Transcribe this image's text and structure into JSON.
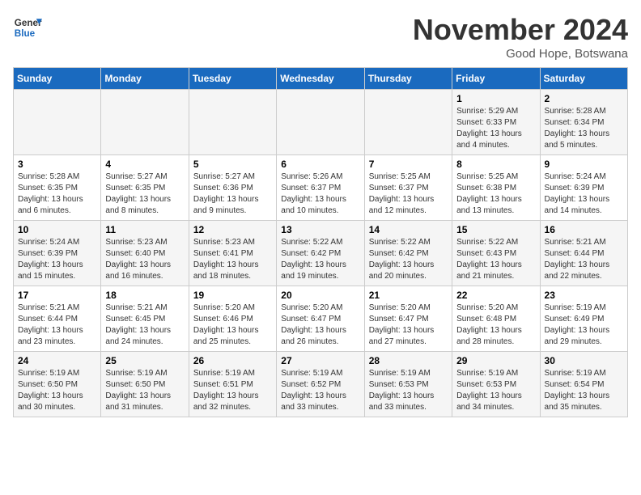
{
  "header": {
    "logo_line1": "General",
    "logo_line2": "Blue",
    "month_year": "November 2024",
    "location": "Good Hope, Botswana"
  },
  "days_of_week": [
    "Sunday",
    "Monday",
    "Tuesday",
    "Wednesday",
    "Thursday",
    "Friday",
    "Saturday"
  ],
  "weeks": [
    [
      {
        "day": "",
        "sunrise": "",
        "sunset": "",
        "daylight": ""
      },
      {
        "day": "",
        "sunrise": "",
        "sunset": "",
        "daylight": ""
      },
      {
        "day": "",
        "sunrise": "",
        "sunset": "",
        "daylight": ""
      },
      {
        "day": "",
        "sunrise": "",
        "sunset": "",
        "daylight": ""
      },
      {
        "day": "",
        "sunrise": "",
        "sunset": "",
        "daylight": ""
      },
      {
        "day": "1",
        "sunrise": "Sunrise: 5:29 AM",
        "sunset": "Sunset: 6:33 PM",
        "daylight": "Daylight: 13 hours and 4 minutes."
      },
      {
        "day": "2",
        "sunrise": "Sunrise: 5:28 AM",
        "sunset": "Sunset: 6:34 PM",
        "daylight": "Daylight: 13 hours and 5 minutes."
      }
    ],
    [
      {
        "day": "3",
        "sunrise": "Sunrise: 5:28 AM",
        "sunset": "Sunset: 6:35 PM",
        "daylight": "Daylight: 13 hours and 6 minutes."
      },
      {
        "day": "4",
        "sunrise": "Sunrise: 5:27 AM",
        "sunset": "Sunset: 6:35 PM",
        "daylight": "Daylight: 13 hours and 8 minutes."
      },
      {
        "day": "5",
        "sunrise": "Sunrise: 5:27 AM",
        "sunset": "Sunset: 6:36 PM",
        "daylight": "Daylight: 13 hours and 9 minutes."
      },
      {
        "day": "6",
        "sunrise": "Sunrise: 5:26 AM",
        "sunset": "Sunset: 6:37 PM",
        "daylight": "Daylight: 13 hours and 10 minutes."
      },
      {
        "day": "7",
        "sunrise": "Sunrise: 5:25 AM",
        "sunset": "Sunset: 6:37 PM",
        "daylight": "Daylight: 13 hours and 12 minutes."
      },
      {
        "day": "8",
        "sunrise": "Sunrise: 5:25 AM",
        "sunset": "Sunset: 6:38 PM",
        "daylight": "Daylight: 13 hours and 13 minutes."
      },
      {
        "day": "9",
        "sunrise": "Sunrise: 5:24 AM",
        "sunset": "Sunset: 6:39 PM",
        "daylight": "Daylight: 13 hours and 14 minutes."
      }
    ],
    [
      {
        "day": "10",
        "sunrise": "Sunrise: 5:24 AM",
        "sunset": "Sunset: 6:39 PM",
        "daylight": "Daylight: 13 hours and 15 minutes."
      },
      {
        "day": "11",
        "sunrise": "Sunrise: 5:23 AM",
        "sunset": "Sunset: 6:40 PM",
        "daylight": "Daylight: 13 hours and 16 minutes."
      },
      {
        "day": "12",
        "sunrise": "Sunrise: 5:23 AM",
        "sunset": "Sunset: 6:41 PM",
        "daylight": "Daylight: 13 hours and 18 minutes."
      },
      {
        "day": "13",
        "sunrise": "Sunrise: 5:22 AM",
        "sunset": "Sunset: 6:42 PM",
        "daylight": "Daylight: 13 hours and 19 minutes."
      },
      {
        "day": "14",
        "sunrise": "Sunrise: 5:22 AM",
        "sunset": "Sunset: 6:42 PM",
        "daylight": "Daylight: 13 hours and 20 minutes."
      },
      {
        "day": "15",
        "sunrise": "Sunrise: 5:22 AM",
        "sunset": "Sunset: 6:43 PM",
        "daylight": "Daylight: 13 hours and 21 minutes."
      },
      {
        "day": "16",
        "sunrise": "Sunrise: 5:21 AM",
        "sunset": "Sunset: 6:44 PM",
        "daylight": "Daylight: 13 hours and 22 minutes."
      }
    ],
    [
      {
        "day": "17",
        "sunrise": "Sunrise: 5:21 AM",
        "sunset": "Sunset: 6:44 PM",
        "daylight": "Daylight: 13 hours and 23 minutes."
      },
      {
        "day": "18",
        "sunrise": "Sunrise: 5:21 AM",
        "sunset": "Sunset: 6:45 PM",
        "daylight": "Daylight: 13 hours and 24 minutes."
      },
      {
        "day": "19",
        "sunrise": "Sunrise: 5:20 AM",
        "sunset": "Sunset: 6:46 PM",
        "daylight": "Daylight: 13 hours and 25 minutes."
      },
      {
        "day": "20",
        "sunrise": "Sunrise: 5:20 AM",
        "sunset": "Sunset: 6:47 PM",
        "daylight": "Daylight: 13 hours and 26 minutes."
      },
      {
        "day": "21",
        "sunrise": "Sunrise: 5:20 AM",
        "sunset": "Sunset: 6:47 PM",
        "daylight": "Daylight: 13 hours and 27 minutes."
      },
      {
        "day": "22",
        "sunrise": "Sunrise: 5:20 AM",
        "sunset": "Sunset: 6:48 PM",
        "daylight": "Daylight: 13 hours and 28 minutes."
      },
      {
        "day": "23",
        "sunrise": "Sunrise: 5:19 AM",
        "sunset": "Sunset: 6:49 PM",
        "daylight": "Daylight: 13 hours and 29 minutes."
      }
    ],
    [
      {
        "day": "24",
        "sunrise": "Sunrise: 5:19 AM",
        "sunset": "Sunset: 6:50 PM",
        "daylight": "Daylight: 13 hours and 30 minutes."
      },
      {
        "day": "25",
        "sunrise": "Sunrise: 5:19 AM",
        "sunset": "Sunset: 6:50 PM",
        "daylight": "Daylight: 13 hours and 31 minutes."
      },
      {
        "day": "26",
        "sunrise": "Sunrise: 5:19 AM",
        "sunset": "Sunset: 6:51 PM",
        "daylight": "Daylight: 13 hours and 32 minutes."
      },
      {
        "day": "27",
        "sunrise": "Sunrise: 5:19 AM",
        "sunset": "Sunset: 6:52 PM",
        "daylight": "Daylight: 13 hours and 33 minutes."
      },
      {
        "day": "28",
        "sunrise": "Sunrise: 5:19 AM",
        "sunset": "Sunset: 6:53 PM",
        "daylight": "Daylight: 13 hours and 33 minutes."
      },
      {
        "day": "29",
        "sunrise": "Sunrise: 5:19 AM",
        "sunset": "Sunset: 6:53 PM",
        "daylight": "Daylight: 13 hours and 34 minutes."
      },
      {
        "day": "30",
        "sunrise": "Sunrise: 5:19 AM",
        "sunset": "Sunset: 6:54 PM",
        "daylight": "Daylight: 13 hours and 35 minutes."
      }
    ]
  ]
}
